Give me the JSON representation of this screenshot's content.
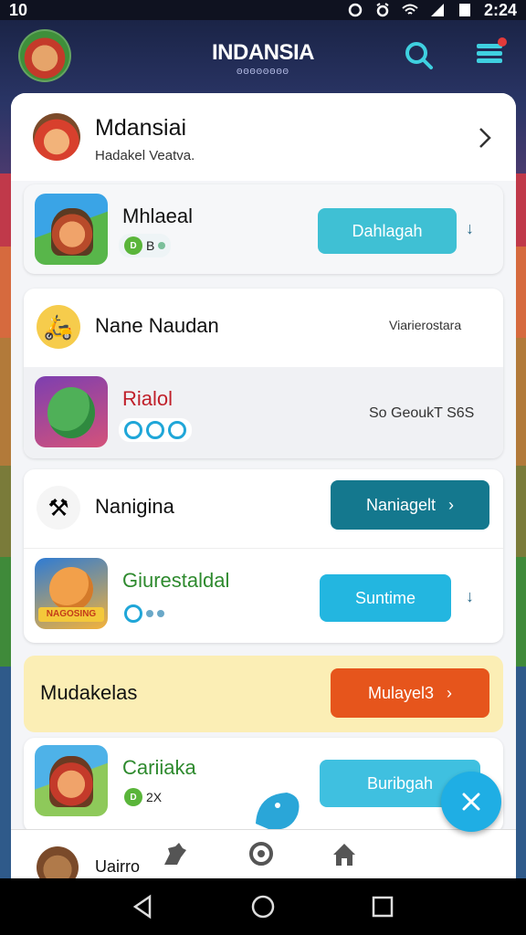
{
  "status_bar": {
    "time_left": "10",
    "time_right": "2:24"
  },
  "header": {
    "title": "INDANSIA",
    "subtitle": "ΘΘΘΘΘΘΘΘ"
  },
  "profile": {
    "name": "Mdansiai",
    "subtitle": "Hadakel Veatva."
  },
  "list": {
    "item1": {
      "title": "Mhlaeal",
      "pill_text": "B",
      "button": "Dahlagah"
    },
    "section2": {
      "header": "Nane Naudan",
      "header_right": "Viarierostara"
    },
    "item2": {
      "title": "Rialol",
      "right_text": "So GeoukT  S6S"
    },
    "section3": {
      "header": "Nanigina",
      "button": "Naniagelt"
    },
    "item3": {
      "title": "Giurestaldal",
      "button": "Suntime",
      "thumb_label": "NAGOSING"
    },
    "promo": {
      "header": "Mudakelas",
      "button": "Mulayel3"
    },
    "item4": {
      "title": "Cariiaka",
      "pill_text": "2X",
      "button": "Buribgah"
    }
  },
  "bottom_nav": {
    "partial_label": "Uairro"
  },
  "colors": {
    "teal_light": "#3fc0d4",
    "teal_dark": "#14788e",
    "cyan": "#23b6e0",
    "orange": "#e6551c",
    "promo_bg": "#fbeeb5",
    "fab": "#1faee4"
  }
}
